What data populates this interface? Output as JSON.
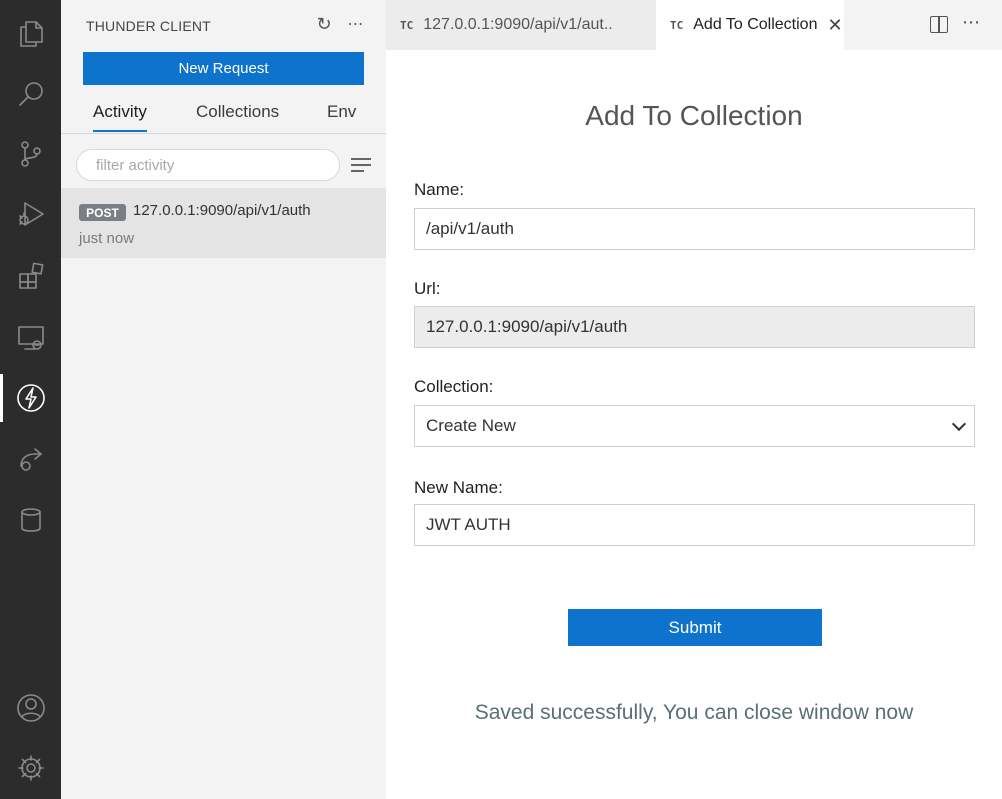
{
  "activity_bar": {
    "icons": [
      "files-icon",
      "search-icon",
      "source-control-icon",
      "run-debug-icon",
      "extensions-icon",
      "remote-explorer-icon",
      "thunder-client-icon",
      "live-share-icon",
      "database-icon",
      "account-icon",
      "settings-gear-icon"
    ],
    "active": "thunder-client-icon"
  },
  "sidebar": {
    "title": "THUNDER CLIENT",
    "new_request_label": "New Request",
    "tabs": [
      {
        "label": "Activity",
        "active": true
      },
      {
        "label": "Collections",
        "active": false
      },
      {
        "label": "Env",
        "active": false
      }
    ],
    "filter_placeholder": "filter activity",
    "activity_items": [
      {
        "method": "POST",
        "url": "127.0.0.1:9090/api/v1/auth",
        "time": "just now"
      }
    ]
  },
  "editor": {
    "tabs": [
      {
        "prefix": "TC",
        "label": "127.0.0.1:9090/api/v1/aut..",
        "active": false
      },
      {
        "prefix": "TC",
        "label": "Add To Collection",
        "active": true,
        "close": "✕"
      }
    ]
  },
  "form": {
    "title": "Add To Collection",
    "name_label": "Name:",
    "name_value": "/api/v1/auth",
    "url_label": "Url:",
    "url_value": "127.0.0.1:9090/api/v1/auth",
    "collection_label": "Collection:",
    "collection_value": "Create New",
    "new_name_label": "New Name:",
    "new_name_value": "JWT AUTH",
    "submit_label": "Submit",
    "success_message": "Saved successfully, You can close window now"
  },
  "colors": {
    "accent": "#0e73cc",
    "activity_bar_bg": "#2c2c2c",
    "sidebar_bg": "#f3f3f3"
  }
}
